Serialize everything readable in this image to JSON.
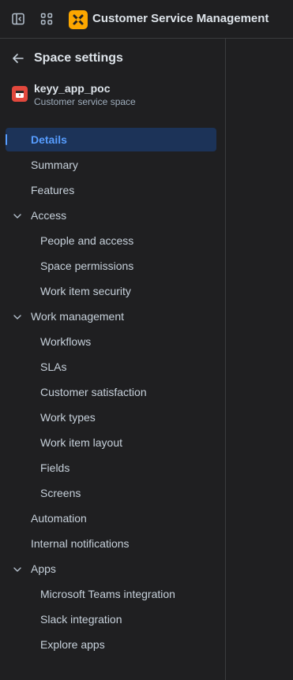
{
  "topbar": {
    "app_title": "Customer Service Management",
    "icons": [
      "sidebar-toggle-icon",
      "app-switcher-icon",
      "csm-logo-icon"
    ]
  },
  "sidebar": {
    "header_title": "Space settings",
    "space": {
      "name": "keyy_app_poc",
      "type": "Customer service space"
    },
    "nav": {
      "details": "Details",
      "summary": "Summary",
      "features": "Features",
      "access": "Access",
      "people_and_access": "People and access",
      "space_permissions": "Space permissions",
      "work_item_security": "Work item security",
      "work_management": "Work management",
      "workflows": "Workflows",
      "slas": "SLAs",
      "customer_satisfaction": "Customer satisfaction",
      "work_types": "Work types",
      "work_item_layout": "Work item layout",
      "fields": "Fields",
      "screens": "Screens",
      "automation": "Automation",
      "internal_notifications": "Internal notifications",
      "apps": "Apps",
      "microsoft_teams_integration": "Microsoft Teams integration",
      "slack_integration": "Slack integration",
      "explore_apps": "Explore apps"
    }
  },
  "colors": {
    "background": "#1f1f21",
    "selected_bg": "#1c3358",
    "accent": "#579dff",
    "logo": "#fca700",
    "space_avatar": "#e2483d"
  }
}
